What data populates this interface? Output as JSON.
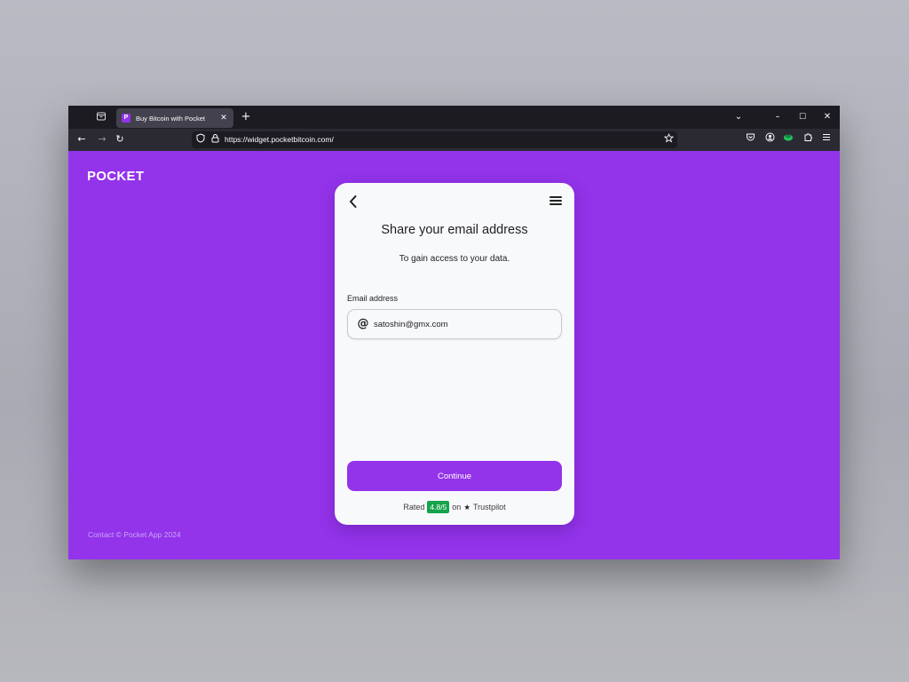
{
  "browser": {
    "tab": {
      "favicon_letter": "P",
      "title": "Buy Bitcoin with Pocket",
      "close_glyph": "✕"
    },
    "new_tab_glyph": "+",
    "window_controls": {
      "list_all_tabs": "⌄",
      "minimize": "–",
      "maximize": "☐",
      "close": "✕"
    },
    "nav": {
      "back": "←",
      "forward": "→",
      "reload": "↻"
    },
    "url": "https://widget.pocketbitcoin.com/",
    "icons": {
      "tab_list": "tab-list-icon",
      "shield": "shield-icon",
      "lock": "lock-icon",
      "bookmark": "star-icon",
      "pocket_save": "pocket-save-icon",
      "account": "account-icon",
      "extension_green": "extension-icon",
      "extensions": "puzzle-icon",
      "menu": "hamburger-icon"
    }
  },
  "page": {
    "logo": "POCKET",
    "footer": "Contact © Pocket App 2024",
    "brand_color": "#9333ea",
    "card": {
      "title": "Share your email address",
      "subtitle": "To gain access to your data.",
      "field_label": "Email address",
      "email_value": "satoshin@gmx.com",
      "at_glyph": "@",
      "continue_label": "Continue",
      "rating": {
        "prefix": "Rated",
        "score": "4.8/5",
        "middle": "on",
        "star": "★",
        "provider": "Trustpilot",
        "score_color": "#16a34a"
      }
    }
  }
}
